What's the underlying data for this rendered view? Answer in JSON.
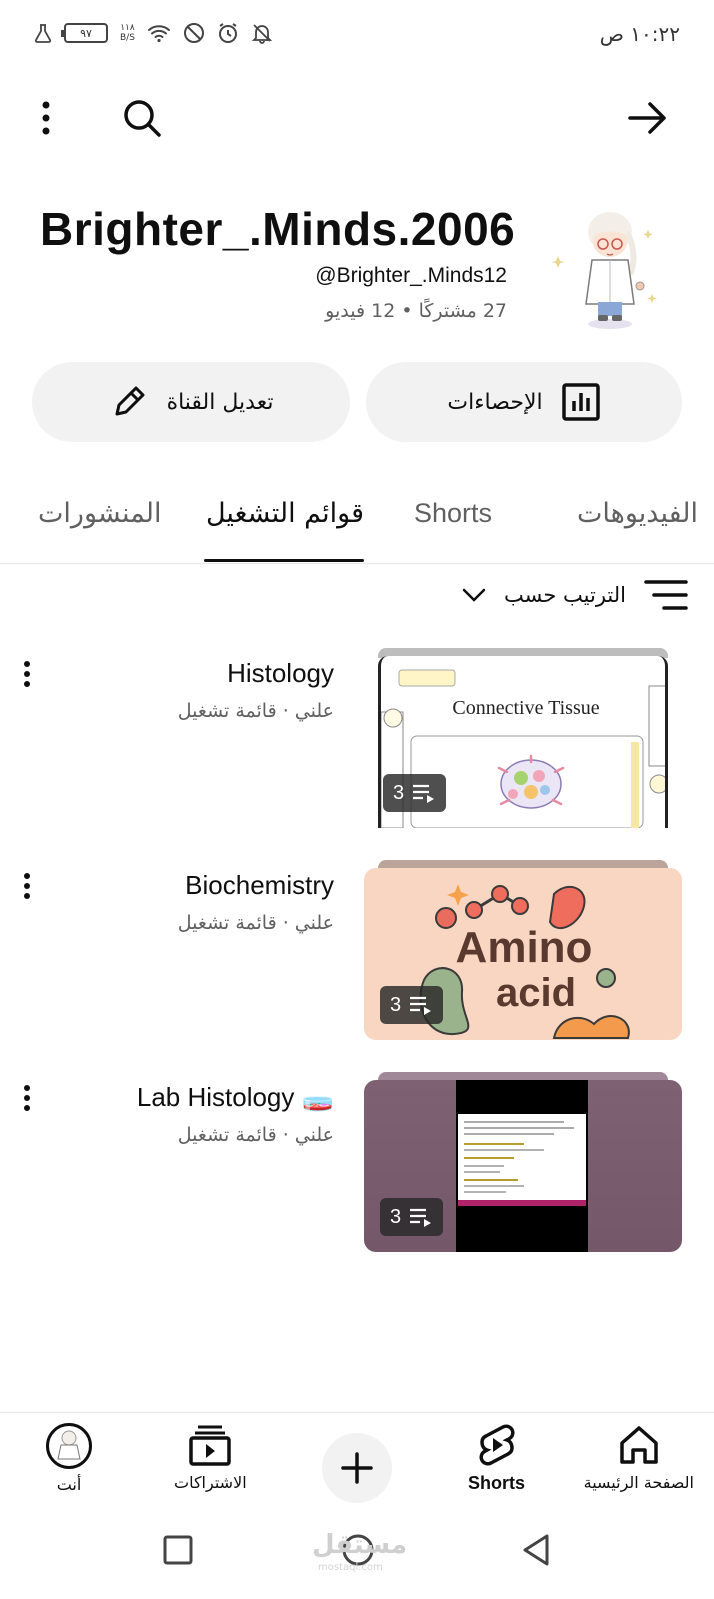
{
  "status": {
    "time": "١٠:٢٢ ص",
    "battery": "٩٧",
    "net_speed_value": "١١٨",
    "net_speed_unit": "B/S"
  },
  "channel": {
    "name": "Brighter_.Minds.2006",
    "handle": "@Brighter_.Minds12",
    "meta": "27 مشتركًا • 12 فيديو"
  },
  "actions": {
    "edit_label": "تعديل القناة",
    "stats_label": "الإحصاءات"
  },
  "tabs": [
    {
      "label": "الفيديوهات",
      "active": false
    },
    {
      "label": "Shorts",
      "active": false
    },
    {
      "label": "قوائم التشغيل",
      "active": true
    },
    {
      "label": "المنشورات",
      "active": false
    }
  ],
  "sort": {
    "label": "الترتيب حسب"
  },
  "playlists": [
    {
      "title": "Histology",
      "subtitle": "علني · قائمة تشغيل",
      "count": "3",
      "thumb_text": "Connective Tissue",
      "thumb_bg": "#ffffff",
      "stack_color": "#bdbdbd"
    },
    {
      "title": "Biochemistry",
      "subtitle": "علني · قائمة تشغيل",
      "count": "3",
      "thumb_text_1": "Amino",
      "thumb_text_2": "acid",
      "thumb_bg": "#f9d6c2",
      "stack_color": "#bba49a"
    },
    {
      "title": "Lab Histology 🧫",
      "subtitle": "علني · قائمة تشغيل",
      "count": "3",
      "thumb_bg": "#7a5a6e",
      "stack_color": "#a08898"
    }
  ],
  "bottom_nav": {
    "home": "الصفحة الرئيسية",
    "shorts": "Shorts",
    "subscriptions": "الاشتراكات",
    "you": "أنت"
  },
  "watermark": {
    "text": "مستقل",
    "sub": "mostaql.com"
  },
  "colors": {
    "text_primary": "#0f0f0f",
    "text_secondary": "#606060",
    "button_bg": "#f2f2f2"
  }
}
